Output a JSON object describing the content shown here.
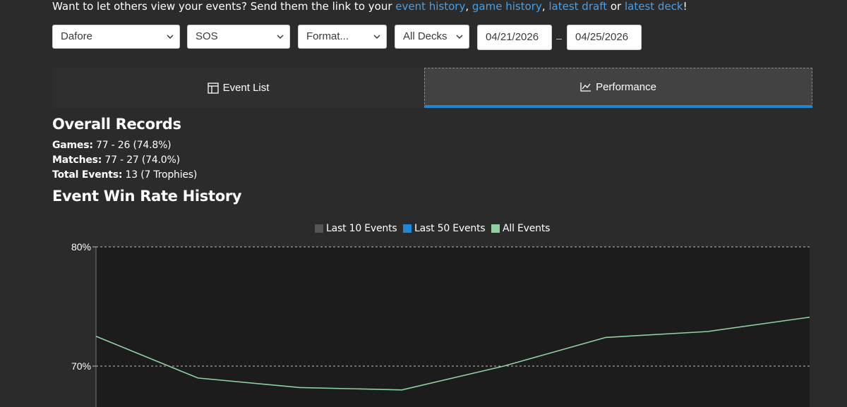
{
  "share": {
    "prefix": "Want to let others view your events? Send them the link to your ",
    "link_event_history": "event history",
    "sep1": ", ",
    "link_game_history": "game history",
    "sep2": ", ",
    "link_latest_draft": "latest draft",
    "or": " or ",
    "link_latest_deck": "latest deck",
    "suffix": "!"
  },
  "filters": {
    "player": "Dafore",
    "set": "SOS",
    "format": "Format...",
    "deck": "All Decks",
    "date_from": "04/21/2026",
    "date_sep": "–",
    "date_to": "04/25/2026"
  },
  "tabs": {
    "event_list": "Event List",
    "performance": "Performance"
  },
  "overall": {
    "heading": "Overall Records",
    "games_label": "Games:",
    "games_value": " 77 - 26 (74.8%)",
    "matches_label": "Matches:",
    "matches_value": " 77 - 27 (74.0%)",
    "events_label": "Total Events:",
    "events_value": " 13 (7 Trophies)"
  },
  "history": {
    "heading": "Event Win Rate History"
  },
  "colors": {
    "link": "#4a9fe4",
    "tab_active_underline": "#1f88d6",
    "series_last10": "#555555",
    "series_last50": "#1f88d6",
    "series_all": "#8fd1a3"
  },
  "chart_data": {
    "type": "line",
    "legend_position": "top-center",
    "y_ticks": [
      "80%",
      "70%"
    ],
    "ylim": [
      65,
      80
    ],
    "grid": true,
    "series": [
      {
        "name": "Last 10 Events",
        "values": []
      },
      {
        "name": "Last 50 Events",
        "values": []
      },
      {
        "name": "All Events",
        "values": [
          72.5,
          69.0,
          68.2,
          68.0,
          70.0,
          72.4,
          72.9,
          74.1
        ]
      }
    ]
  }
}
